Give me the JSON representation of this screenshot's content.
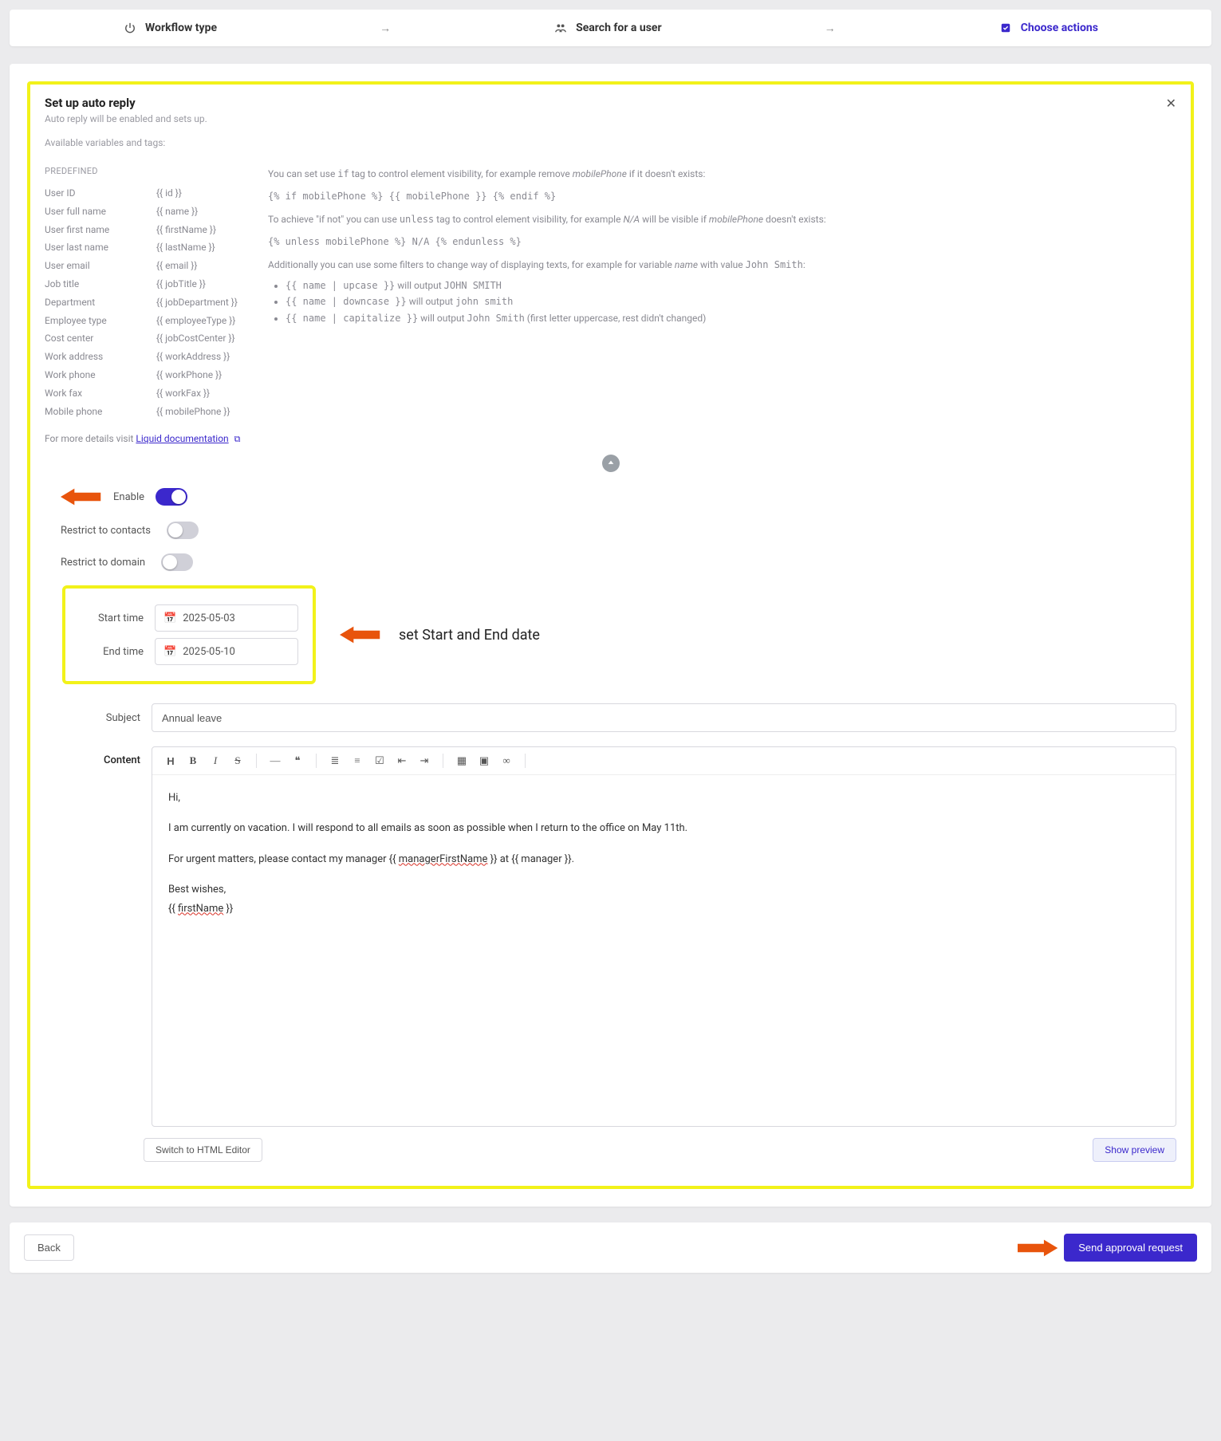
{
  "stepper": {
    "step1": "Workflow type",
    "step2": "Search for a user",
    "step3": "Choose actions"
  },
  "panel": {
    "title": "Set up auto reply",
    "subtitle": "Auto reply will be enabled and sets up.",
    "available_vars": "Available variables and tags:",
    "predefined": "PREDEFINED",
    "liquid_prefix": "For more details visit ",
    "liquid_link": "Liquid documentation"
  },
  "vars": [
    {
      "label": "User ID",
      "token": "{{ id }}"
    },
    {
      "label": "User full name",
      "token": "{{ name }}"
    },
    {
      "label": "User first name",
      "token": "{{ firstName }}"
    },
    {
      "label": "User last name",
      "token": "{{ lastName }}"
    },
    {
      "label": "User email",
      "token": "{{ email }}"
    },
    {
      "label": "Job title",
      "token": "{{ jobTitle }}"
    },
    {
      "label": "Department",
      "token": "{{ jobDepartment }}"
    },
    {
      "label": "Employee type",
      "token": "{{ employeeType }}"
    },
    {
      "label": "Cost center",
      "token": "{{ jobCostCenter }}"
    },
    {
      "label": "Work address",
      "token": "{{ workAddress }}"
    },
    {
      "label": "Work phone",
      "token": "{{ workPhone }}"
    },
    {
      "label": "Work fax",
      "token": "{{ workFax }}"
    },
    {
      "label": "Mobile phone",
      "token": "{{ mobilePhone }}"
    }
  ],
  "help": {
    "l1a": "You can set use ",
    "l1_code1": "if",
    "l1b": " tag to control element visibility, for example remove ",
    "l1_em": "mobilePhone",
    "l1c": " if it doesn't exists:",
    "l1_example": "{% if mobilePhone %} {{ mobilePhone }} {% endif %}",
    "l2a": "To achieve \"if not\" you can use ",
    "l2_code1": "unless",
    "l2b": " tag to control element visibility, for example ",
    "l2_em": "N/A",
    "l2c": " will be visible if ",
    "l2_em2": "mobilePhone",
    "l2d": " doesn't exists:",
    "l2_example": "{% unless mobilePhone %} N/A {% endunless %}",
    "l3a": "Additionally you can use some filters to change way of displaying texts, for example for variable ",
    "l3_em": "name",
    "l3b": " with value ",
    "l3_code": "John Smith",
    "l3c": ":",
    "b1_code": "{{ name | upcase }}",
    "b1_text": " will output ",
    "b1_out": "JOHN SMITH",
    "b2_code": "{{ name | downcase }}",
    "b2_text": " will output ",
    "b2_out": "john smith",
    "b3_code": "{{ name | capitalize }}",
    "b3_text": " will output ",
    "b3_out": "John Smith",
    "b3_suffix": " (first letter uppercase, rest didn't changed)"
  },
  "form": {
    "enable": "Enable",
    "restrict_contacts": "Restrict to contacts",
    "restrict_domain": "Restrict to domain",
    "start_time": "Start time",
    "end_time": "End time",
    "start_value": "2025-05-03",
    "end_value": "2025-05-10",
    "subject_label": "Subject",
    "subject_value": "Annual leave",
    "content_label": "Content",
    "callout": "set Start and End date"
  },
  "editor": {
    "p1": "Hi,",
    "p2": "I am currently on vacation. I will respond to all emails as soon as possible when I return to the office on May 11th.",
    "p3a": "For urgent matters, please contact my manager {{ ",
    "p3_red": "managerFirstName",
    "p3b": " }} at {{ manager }}.",
    "p4": "Best wishes,",
    "p5a": "{{ ",
    "p5_red": "firstName",
    "p5b": " }}"
  },
  "buttons": {
    "switch_html": "Switch to HTML Editor",
    "show_preview": "Show preview",
    "back": "Back",
    "send": "Send approval request"
  }
}
